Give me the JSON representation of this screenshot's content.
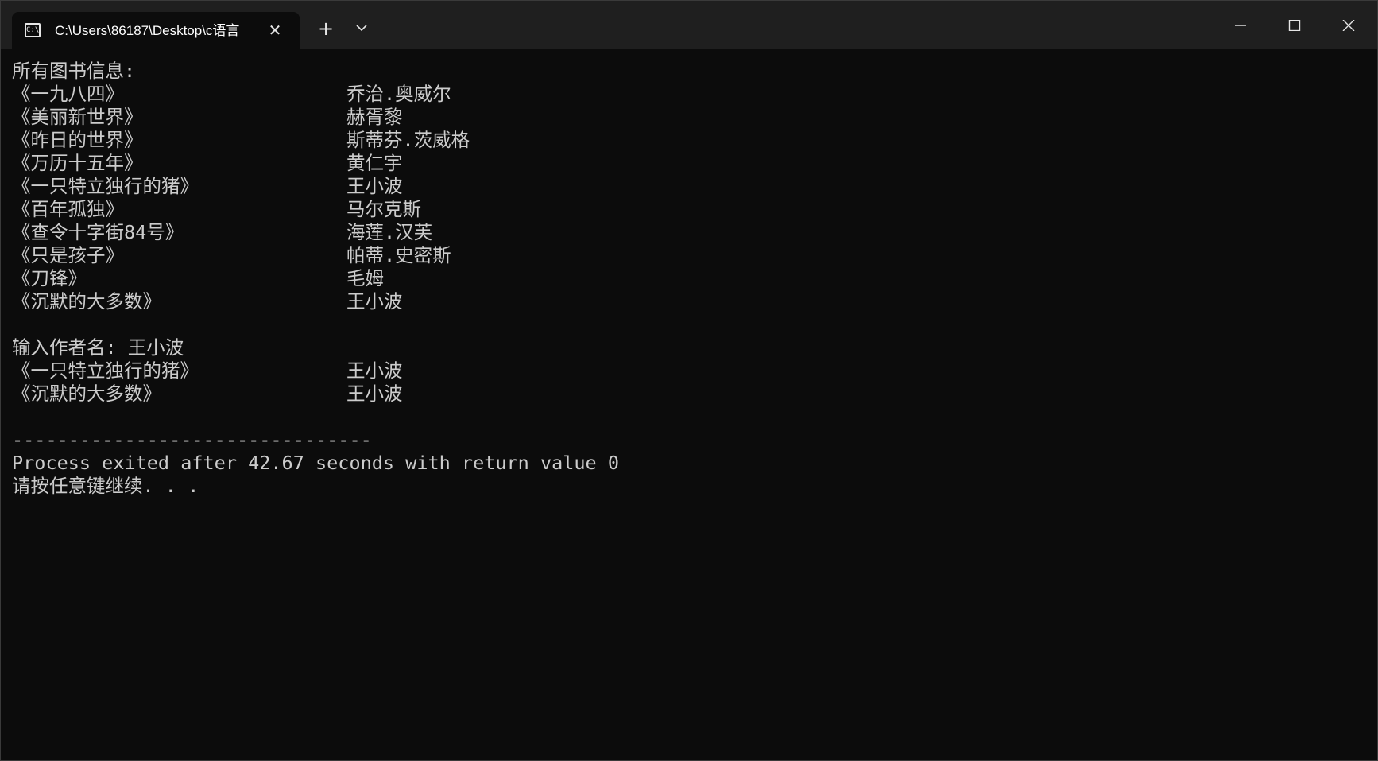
{
  "window": {
    "tab_title": "C:\\Users\\86187\\Desktop\\c语言",
    "tab_icon": "terminal-icon",
    "tab_icon_text": "C:\\"
  },
  "console": {
    "header": "所有图书信息:",
    "books": [
      {
        "title": "《一九八四》",
        "author": "乔治.奥威尔"
      },
      {
        "title": "《美丽新世界》",
        "author": "赫胥黎"
      },
      {
        "title": "《昨日的世界》",
        "author": "斯蒂芬.茨威格"
      },
      {
        "title": "《万历十五年》",
        "author": "黄仁宇"
      },
      {
        "title": "《一只特立独行的猪》",
        "author": "王小波"
      },
      {
        "title": "《百年孤独》",
        "author": "马尔克斯"
      },
      {
        "title": "《查令十字街84号》",
        "author": "海莲.汉芙"
      },
      {
        "title": "《只是孩子》",
        "author": "帕蒂.史密斯"
      },
      {
        "title": "《刀锋》",
        "author": "毛姆"
      },
      {
        "title": "《沉默的大多数》",
        "author": "王小波"
      }
    ],
    "prompt": "输入作者名: 王小波",
    "results": [
      {
        "title": "《一只特立独行的猪》",
        "author": "王小波"
      },
      {
        "title": "《沉默的大多数》",
        "author": "王小波"
      }
    ],
    "separator": "--------------------------------",
    "exit_message": "Process exited after 42.67 seconds with return value 0",
    "continue_message": "请按任意键继续. . ."
  }
}
